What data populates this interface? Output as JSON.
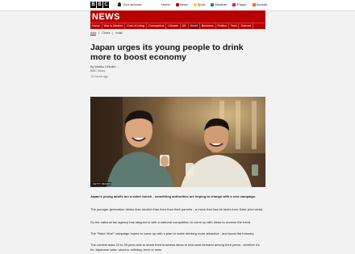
{
  "brand": {
    "letters": [
      "B",
      "B",
      "C"
    ],
    "section": "NEWS"
  },
  "account": {
    "label": "Your account"
  },
  "top_nav": [
    {
      "label": "Home",
      "color": ""
    },
    {
      "label": "News",
      "color": "#b80000"
    },
    {
      "label": "Sport",
      "color": "#ffd230"
    },
    {
      "label": "Weather",
      "color": "#1b7ab8"
    },
    {
      "label": "iPlayer",
      "color": "#e4007c"
    },
    {
      "label": "Sounds",
      "color": "#ff6600"
    }
  ],
  "sections": [
    "Home",
    "War in Ukraine",
    "Cost of Living",
    "Coronavirus",
    "Climate",
    "UK",
    "World",
    "Business",
    "Politics",
    "Tech",
    "Science"
  ],
  "active_section": "World",
  "subnav": [
    "Asia",
    "China",
    "India"
  ],
  "article": {
    "headline": "Japan urges its young people to drink more to boost economy",
    "author": "By Mariko Oi/Katie ...",
    "role": "BBC News",
    "time": "13 hours ago",
    "image_credit": "GETTY IMAGES",
    "paragraphs": [
      "Japan's young adults are a sober bunch - something authorities are hoping to change with a new campaign.",
      "The younger generation drinks less alcohol than their than their parents - a move that has hit taxes from Sake (rice wine).",
      "So the national tax agency has stepped in with a national competition to come up with ideas to reverse the trend.",
      "The \"Sake Viva!\" campaign hopes to come up with a plan to make drinking more attractive - and boost the industry.",
      "The contest asks 20 to 39-year-olds to share their business ideas to kick-start demand among their peers - whether it's for Japanese sake, shochu, whiskey, beer or wine.",
      "The group running the competition for the tax authority says new habits..."
    ]
  }
}
